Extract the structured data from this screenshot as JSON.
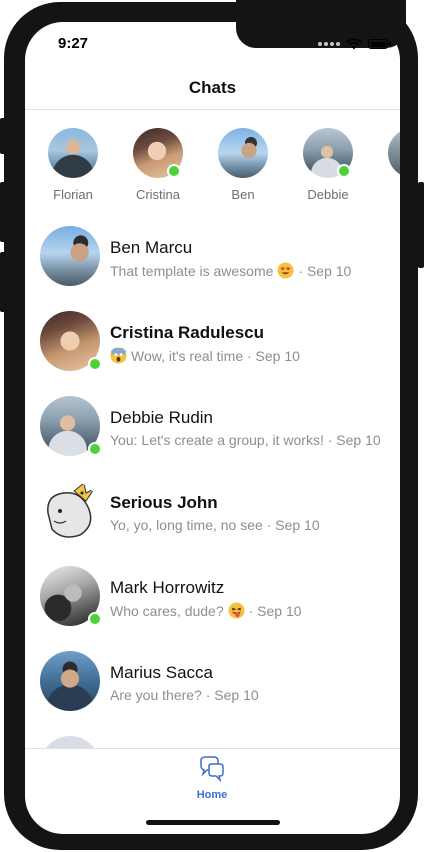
{
  "status": {
    "time": "9:27"
  },
  "header": {
    "title": "Chats"
  },
  "stories": [
    {
      "name": "Florian",
      "online": false
    },
    {
      "name": "Cristina",
      "online": true
    },
    {
      "name": "Ben",
      "online": false
    },
    {
      "name": "Debbie",
      "online": true
    },
    {
      "name": "",
      "online": false
    }
  ],
  "chats": [
    {
      "name": "Ben Marcu",
      "bold": false,
      "online": false,
      "message": "That template is awesome",
      "emoji": "heart-eyes-emoji",
      "date": "· Sep 10"
    },
    {
      "name": "Cristina Radulescu",
      "bold": true,
      "online": true,
      "message": "Wow, it's real time · Sep 10",
      "emoji_before": "scream-emoji"
    },
    {
      "name": "Debbie Rudin",
      "bold": false,
      "online": true,
      "message": "You: Let's create a group, it works! · Sep 10"
    },
    {
      "name": "Serious John",
      "bold": true,
      "online": false,
      "message": "Yo, yo, long time, no see · Sep 10"
    },
    {
      "name": "Mark Horrowitz",
      "bold": false,
      "online": true,
      "message": "Who cares, dude?",
      "emoji": "tongue-emoji",
      "date": "· Sep 10"
    },
    {
      "name": "Marius Sacca",
      "bold": false,
      "online": false,
      "message": "Are you there? · Sep 10"
    }
  ],
  "tabbar": {
    "home_label": "Home"
  },
  "colors": {
    "accent": "#3b6fd1",
    "online": "#4cd137",
    "muted": "#8e8e93"
  }
}
